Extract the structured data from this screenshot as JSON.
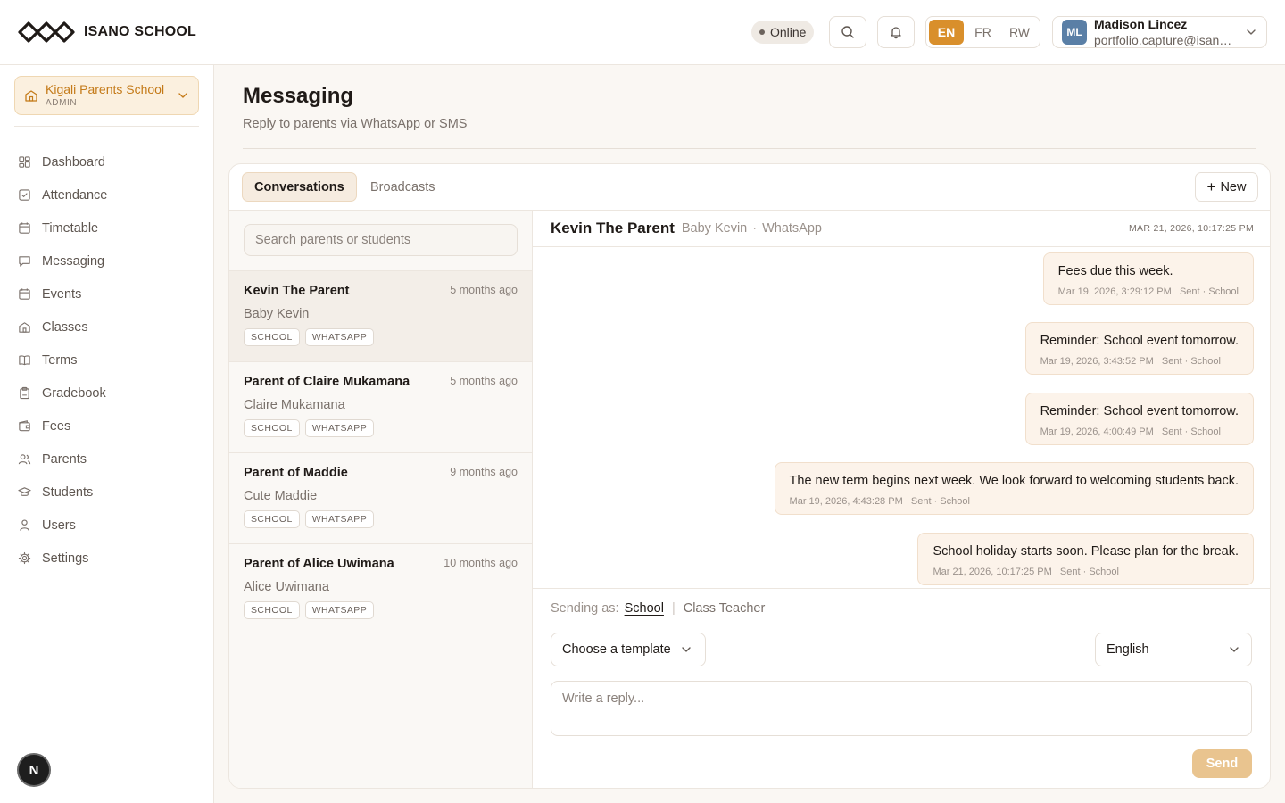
{
  "brand": {
    "name": "ISANO SCHOOL"
  },
  "header": {
    "status": "Online",
    "languages": [
      {
        "code": "EN",
        "active": true
      },
      {
        "code": "FR",
        "active": false
      },
      {
        "code": "RW",
        "active": false
      }
    ],
    "user": {
      "initials": "ML",
      "name": "Madison Lincez",
      "email": "portfolio.capture@isano.school"
    }
  },
  "sidebar": {
    "school": {
      "name": "Kigali Parents School",
      "role": "ADMIN"
    },
    "items": [
      {
        "label": "Dashboard",
        "icon": "dashboard-icon"
      },
      {
        "label": "Attendance",
        "icon": "check-square-icon"
      },
      {
        "label": "Timetable",
        "icon": "calendar-icon"
      },
      {
        "label": "Messaging",
        "icon": "message-icon"
      },
      {
        "label": "Events",
        "icon": "calendar-icon"
      },
      {
        "label": "Classes",
        "icon": "building-icon"
      },
      {
        "label": "Terms",
        "icon": "book-icon"
      },
      {
        "label": "Gradebook",
        "icon": "clipboard-icon"
      },
      {
        "label": "Fees",
        "icon": "wallet-icon"
      },
      {
        "label": "Parents",
        "icon": "users-icon"
      },
      {
        "label": "Students",
        "icon": "graduation-cap-icon"
      },
      {
        "label": "Users",
        "icon": "user-icon"
      },
      {
        "label": "Settings",
        "icon": "gear-icon"
      }
    ],
    "fab_label": "N"
  },
  "page": {
    "title": "Messaging",
    "subtitle": "Reply to parents via WhatsApp or SMS"
  },
  "tabs": [
    {
      "label": "Conversations",
      "active": true
    },
    {
      "label": "Broadcasts",
      "active": false
    }
  ],
  "new_button": "New",
  "search": {
    "placeholder": "Search parents or students"
  },
  "conversations": [
    {
      "name": "Kevin The Parent",
      "time": "5 months ago",
      "student": "Baby Kevin",
      "tags": [
        "SCHOOL",
        "WHATSAPP"
      ],
      "active": true
    },
    {
      "name": "Parent of Claire Mukamana",
      "time": "5 months ago",
      "student": "Claire Mukamana",
      "tags": [
        "SCHOOL",
        "WHATSAPP"
      ],
      "active": false
    },
    {
      "name": "Parent of Maddie",
      "time": "9 months ago",
      "student": "Cute Maddie",
      "tags": [
        "SCHOOL",
        "WHATSAPP"
      ],
      "active": false
    },
    {
      "name": "Parent of Alice Uwimana",
      "time": "10 months ago",
      "student": "Alice Uwimana",
      "tags": [
        "SCHOOL",
        "WHATSAPP"
      ],
      "active": false
    }
  ],
  "chat": {
    "name": "Kevin The Parent",
    "student": "Baby Kevin",
    "channel": "WhatsApp",
    "timestamp": "MAR 21, 2026, 10:17:25 PM",
    "messages": [
      {
        "text": "Fees due this week.",
        "time": "Mar 19, 2026, 3:29:12 PM",
        "status": "Sent · School"
      },
      {
        "text": "Reminder: School event tomorrow.",
        "time": "Mar 19, 2026, 3:43:52 PM",
        "status": "Sent · School"
      },
      {
        "text": "Reminder: School event tomorrow.",
        "time": "Mar 19, 2026, 4:00:49 PM",
        "status": "Sent · School"
      },
      {
        "text": "The new term begins next week. We look forward to welcoming students back.",
        "time": "Mar 19, 2026, 4:43:28 PM",
        "status": "Sent · School"
      },
      {
        "text": "School holiday starts soon. Please plan for the break.",
        "time": "Mar 21, 2026, 10:17:25 PM",
        "status": "Sent · School"
      }
    ]
  },
  "composer": {
    "sending_as_label": "Sending as:",
    "sender_active": "School",
    "sender_option": "Class Teacher",
    "template_placeholder": "Choose a template",
    "language": "English",
    "reply_placeholder": "Write a reply...",
    "send_label": "Send"
  },
  "colors": {
    "accent": "#d98f2b",
    "accent_light": "#fbf0df",
    "bubble": "#fcf3ea",
    "send_disabled": "#e9c48f"
  }
}
